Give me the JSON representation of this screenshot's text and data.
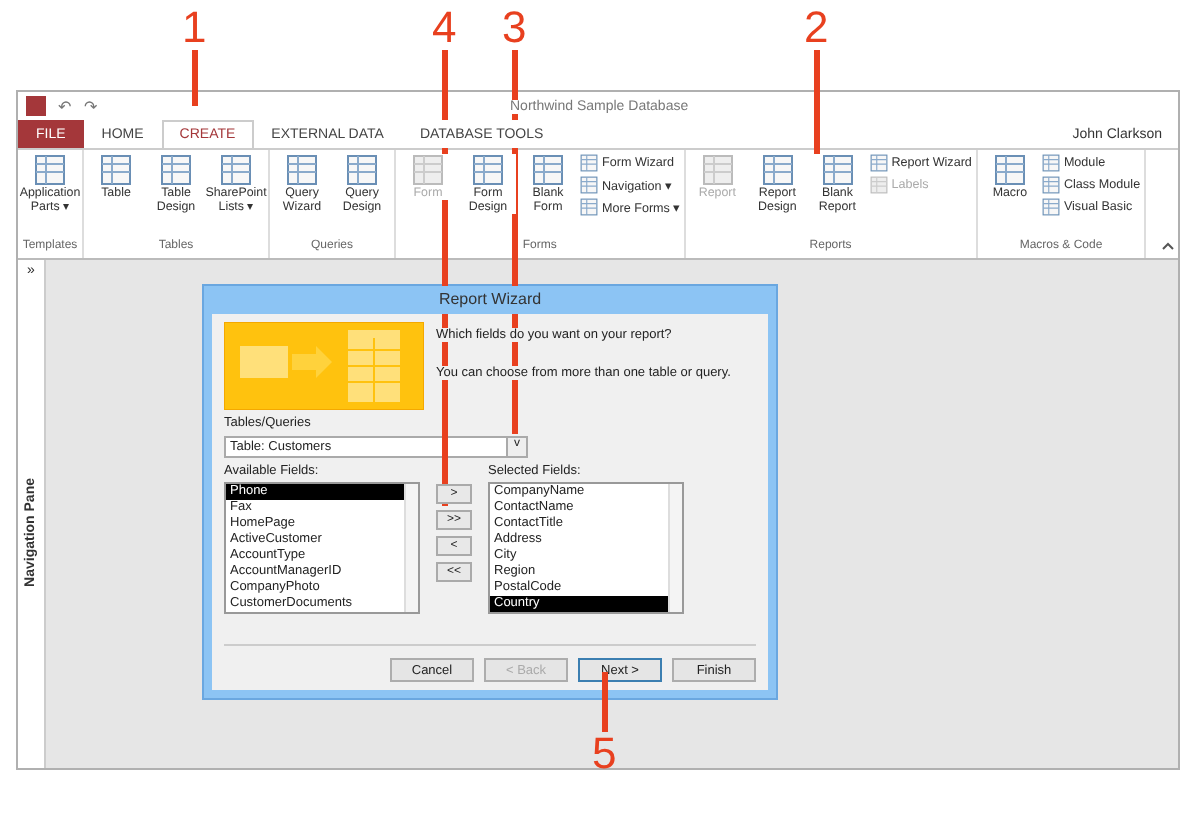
{
  "callouts": [
    {
      "label": "1"
    },
    {
      "label": "4"
    },
    {
      "label": "3"
    },
    {
      "label": "2"
    },
    {
      "label": "5"
    }
  ],
  "window": {
    "title": "Northwind Sample Database",
    "user": "John Clarkson",
    "quick_access": [
      "↶",
      "↷"
    ]
  },
  "tabs": [
    {
      "label": "FILE",
      "kind": "file",
      "selected": false
    },
    {
      "label": "HOME",
      "kind": "tab",
      "selected": false
    },
    {
      "label": "CREATE",
      "kind": "tab",
      "selected": true
    },
    {
      "label": "EXTERNAL DATA",
      "kind": "tab",
      "selected": false
    },
    {
      "label": "DATABASE TOOLS",
      "kind": "tab",
      "selected": false
    }
  ],
  "ribbon_groups": [
    {
      "name": "Templates",
      "large": [
        {
          "label": "Application Parts ▾",
          "disabled": false
        }
      ]
    },
    {
      "name": "Tables",
      "large": [
        {
          "label": "Table",
          "disabled": false
        },
        {
          "label": "Table Design",
          "disabled": false
        },
        {
          "label": "SharePoint Lists ▾",
          "disabled": false
        }
      ]
    },
    {
      "name": "Queries",
      "large": [
        {
          "label": "Query Wizard",
          "disabled": false
        },
        {
          "label": "Query Design",
          "disabled": false
        }
      ]
    },
    {
      "name": "Forms",
      "large": [
        {
          "label": "Form",
          "disabled": true
        },
        {
          "label": "Form Design",
          "disabled": false
        },
        {
          "label": "Blank Form",
          "disabled": false
        }
      ],
      "small": [
        {
          "label": "Form Wizard",
          "disabled": false
        },
        {
          "label": "Navigation ▾",
          "disabled": false
        },
        {
          "label": "More Forms ▾",
          "disabled": false
        }
      ]
    },
    {
      "name": "Reports",
      "large": [
        {
          "label": "Report",
          "disabled": true
        },
        {
          "label": "Report Design",
          "disabled": false
        },
        {
          "label": "Blank Report",
          "disabled": false
        }
      ],
      "small": [
        {
          "label": "Report Wizard",
          "disabled": false
        },
        {
          "label": "Labels",
          "disabled": true
        }
      ]
    },
    {
      "name": "Macros & Code",
      "large": [
        {
          "label": "Macro",
          "disabled": false
        }
      ],
      "small": [
        {
          "label": "Module",
          "disabled": false
        },
        {
          "label": "Class Module",
          "disabled": false
        },
        {
          "label": "Visual Basic",
          "disabled": false
        }
      ]
    }
  ],
  "nav_pane": {
    "toggle": "»",
    "label": "Navigation Pane"
  },
  "dialog": {
    "title": "Report Wizard",
    "prompt": "Which fields do you want on your report?",
    "hint": "You can choose from more than one table or query.",
    "source_label": "Tables/Queries",
    "source_value": "Table: Customers",
    "dropdown_arrow": "v",
    "available_label": "Available Fields:",
    "available": [
      {
        "label": "Phone",
        "selected": true
      },
      {
        "label": "Fax",
        "selected": false
      },
      {
        "label": "HomePage",
        "selected": false
      },
      {
        "label": "ActiveCustomer",
        "selected": false
      },
      {
        "label": "AccountType",
        "selected": false
      },
      {
        "label": "AccountManagerID",
        "selected": false
      },
      {
        "label": "CompanyPhoto",
        "selected": false
      },
      {
        "label": "CustomerDocuments",
        "selected": false
      }
    ],
    "move_buttons": [
      ">",
      ">>",
      "<",
      "<<"
    ],
    "selected_label": "Selected Fields:",
    "selected_fields": [
      {
        "label": "CompanyName",
        "selected": false
      },
      {
        "label": "ContactName",
        "selected": false
      },
      {
        "label": "ContactTitle",
        "selected": false
      },
      {
        "label": "Address",
        "selected": false
      },
      {
        "label": "City",
        "selected": false
      },
      {
        "label": "Region",
        "selected": false
      },
      {
        "label": "PostalCode",
        "selected": false
      },
      {
        "label": "Country",
        "selected": true
      }
    ],
    "buttons": [
      {
        "label": "Cancel",
        "disabled": false,
        "default": false
      },
      {
        "label": "< Back",
        "disabled": true,
        "default": false
      },
      {
        "label": "Next >",
        "disabled": false,
        "default": true
      },
      {
        "label": "Finish",
        "disabled": false,
        "default": false
      }
    ]
  }
}
